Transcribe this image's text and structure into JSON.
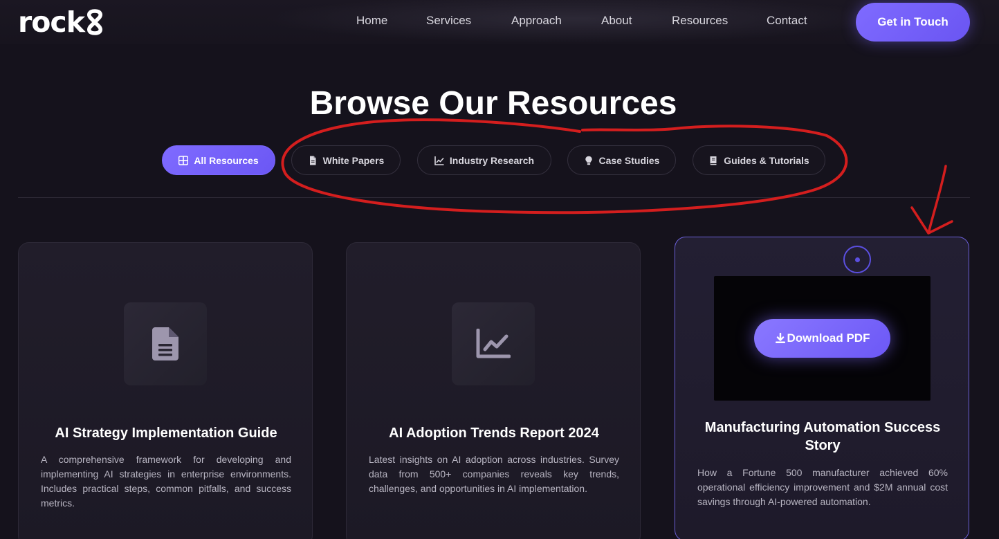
{
  "nav": {
    "logo_text": "rock",
    "links": [
      "Home",
      "Services",
      "Approach",
      "About",
      "Resources",
      "Contact"
    ],
    "cta_label": "Get in Touch",
    "logo_icon": "infinity-8-icon"
  },
  "page": {
    "title": "Browse Our Resources"
  },
  "filters": [
    {
      "label": "All Resources",
      "icon": "grid-icon",
      "active": true
    },
    {
      "label": "White Papers",
      "icon": "file-icon",
      "active": false
    },
    {
      "label": "Industry Research",
      "icon": "line-chart-icon",
      "active": false
    },
    {
      "label": "Case Studies",
      "icon": "lightbulb-icon",
      "active": false
    },
    {
      "label": "Guides & Tutorials",
      "icon": "book-icon",
      "active": false
    }
  ],
  "cards": [
    {
      "icon": "document-icon",
      "title": "AI Strategy Implementation Guide",
      "description": "A comprehensive framework for developing and implementing AI strategies in enterprise environments. Includes practical steps, common pitfalls, and success metrics."
    },
    {
      "icon": "line-chart-icon",
      "title": "AI Adoption Trends Report 2024",
      "description": "Latest insights on AI adoption across industries. Survey data from 500+ companies reveals key trends, challenges, and opportunities in AI implementation."
    },
    {
      "icon": "download-icon",
      "title": "Manufacturing Automation Success Story",
      "description": "How a Fortune 500 manufacturer achieved 60% operational efficiency improvement and $2M annual cost savings through AI-powered automation.",
      "button_label": "Download PDF"
    }
  ],
  "colors": {
    "background": "#15121c",
    "accent": "#7461fa",
    "annotation": "#d41e1e"
  }
}
